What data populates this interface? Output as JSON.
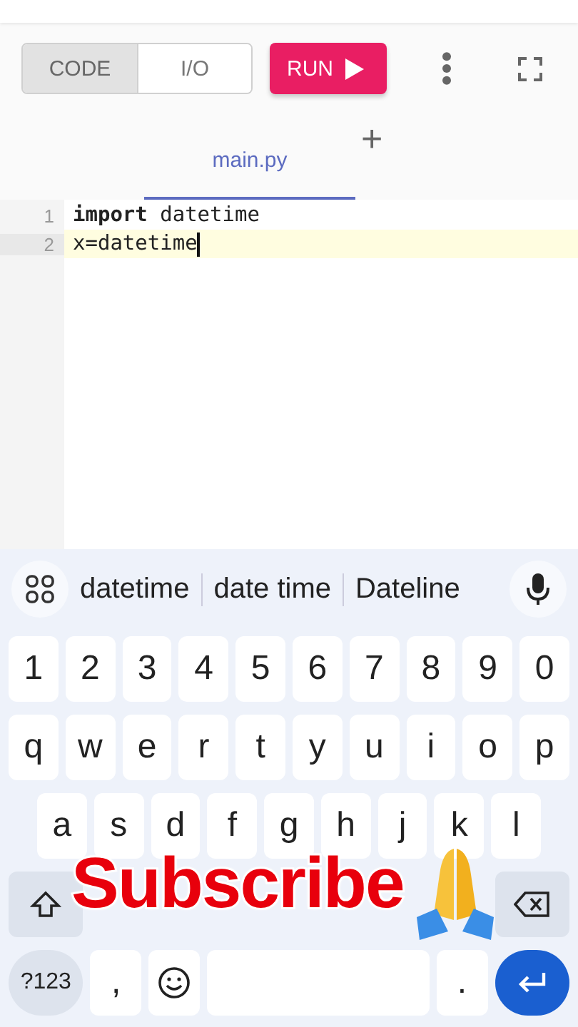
{
  "toolbar": {
    "mode_toggle": [
      {
        "label": "CODE",
        "selected": true
      },
      {
        "label": "I/O",
        "selected": false
      }
    ],
    "run_button": {
      "label": "RUN"
    }
  },
  "file_tabs": {
    "tabs": [
      {
        "label": "main.py",
        "selected": true
      }
    ],
    "add_tab": "+"
  },
  "editor": {
    "lines": [
      {
        "number": "1",
        "text": "**import** datetime",
        "current": false
      },
      {
        "number": "2",
        "text": "x=datetime",
        "current": true
      }
    ]
  },
  "keyboard": {
    "suggestions": [
      "datetime",
      "date time",
      "Dateline"
    ],
    "rows": [
      {
        "keys": [
          {
            "kind": "char",
            "label": "1"
          },
          {
            "kind": "char",
            "label": "2"
          },
          {
            "kind": "char",
            "label": "3"
          },
          {
            "kind": "char",
            "label": "4"
          },
          {
            "kind": "char",
            "label": "5"
          },
          {
            "kind": "char",
            "label": "6"
          },
          {
            "kind": "char",
            "label": "7"
          },
          {
            "kind": "char",
            "label": "8"
          },
          {
            "kind": "char",
            "label": "9"
          },
          {
            "kind": "char",
            "label": "0"
          }
        ]
      },
      {
        "keys": [
          {
            "kind": "char",
            "label": "q"
          },
          {
            "kind": "char",
            "label": "w"
          },
          {
            "kind": "char",
            "label": "e"
          },
          {
            "kind": "char",
            "label": "r"
          },
          {
            "kind": "char",
            "label": "t"
          },
          {
            "kind": "char",
            "label": "y"
          },
          {
            "kind": "char",
            "label": "u"
          },
          {
            "kind": "char",
            "label": "i"
          },
          {
            "kind": "char",
            "label": "o"
          },
          {
            "kind": "char",
            "label": "p"
          }
        ]
      },
      {
        "keys": [
          {
            "kind": "char",
            "label": "a"
          },
          {
            "kind": "char",
            "label": "s"
          },
          {
            "kind": "char",
            "label": "d"
          },
          {
            "kind": "char",
            "label": "f"
          },
          {
            "kind": "char",
            "label": "g"
          },
          {
            "kind": "char",
            "label": "h"
          },
          {
            "kind": "char",
            "label": "j"
          },
          {
            "kind": "char",
            "label": "k"
          },
          {
            "kind": "char",
            "label": "l"
          }
        ]
      },
      {
        "keys": [
          {
            "kind": "shift"
          },
          {
            "kind": "covered"
          },
          {
            "kind": "covered"
          },
          {
            "kind": "covered"
          },
          {
            "kind": "covered"
          },
          {
            "kind": "covered"
          },
          {
            "kind": "covered"
          },
          {
            "kind": "covered"
          },
          {
            "kind": "backspace"
          }
        ]
      },
      {
        "keys": [
          {
            "kind": "symbols",
            "label": "?123"
          },
          {
            "kind": "char",
            "label": ","
          },
          {
            "kind": "emoji"
          },
          {
            "kind": "space"
          },
          {
            "kind": "char",
            "label": "."
          },
          {
            "kind": "enter"
          }
        ]
      }
    ]
  },
  "overlay": {
    "text": "Subscribe"
  }
}
